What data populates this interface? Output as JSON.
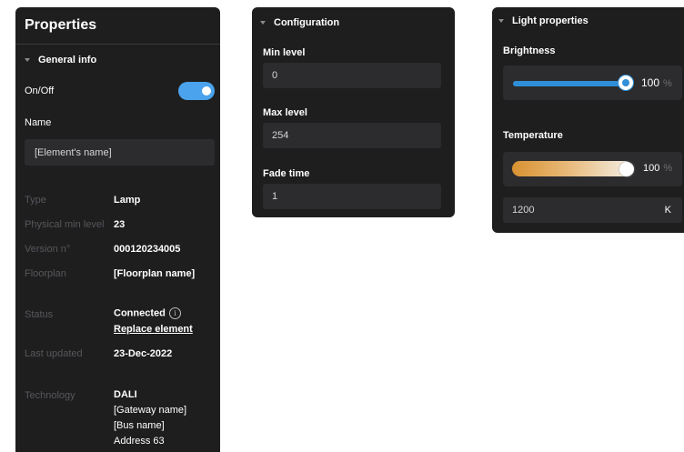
{
  "properties": {
    "title": "Properties",
    "section": "General info",
    "onoff_label": "On/Off",
    "onoff_state": true,
    "name_label": "Name",
    "name_value": "[Element's name]",
    "info": {
      "type_key": "Type",
      "type_val": "Lamp",
      "physmin_key": "Physical min level",
      "physmin_val": "23",
      "version_key": "Version n°",
      "version_val": "000120234005",
      "floorplan_key": "Floorplan",
      "floorplan_val": "[Floorplan name]",
      "status_key": "Status",
      "status_val": "Connected",
      "replace_link": "Replace element",
      "updated_key": "Last updated",
      "updated_val": "23-Dec-2022",
      "tech_key": "Technology",
      "tech_val": "DALI",
      "tech_gateway": "[Gateway name]",
      "tech_bus": "[Bus name]",
      "tech_address": "Address 63"
    }
  },
  "configuration": {
    "title": "Configuration",
    "min_label": "Min level",
    "min_value": "0",
    "max_label": "Max level",
    "max_value": "254",
    "fade_label": "Fade time",
    "fade_value": "1"
  },
  "light": {
    "title": "Light properties",
    "brightness_label": "Brightness",
    "brightness_value": "100",
    "brightness_unit": "%",
    "temperature_label": "Temperature",
    "temperature_value": "100",
    "temperature_unit": "%",
    "kelvin_value": "1200",
    "kelvin_unit": "K"
  },
  "colors": {
    "panel": "#1e1e1f",
    "field": "#2c2c2e",
    "accent": "#4aa3ec",
    "warm": "#d99231"
  }
}
